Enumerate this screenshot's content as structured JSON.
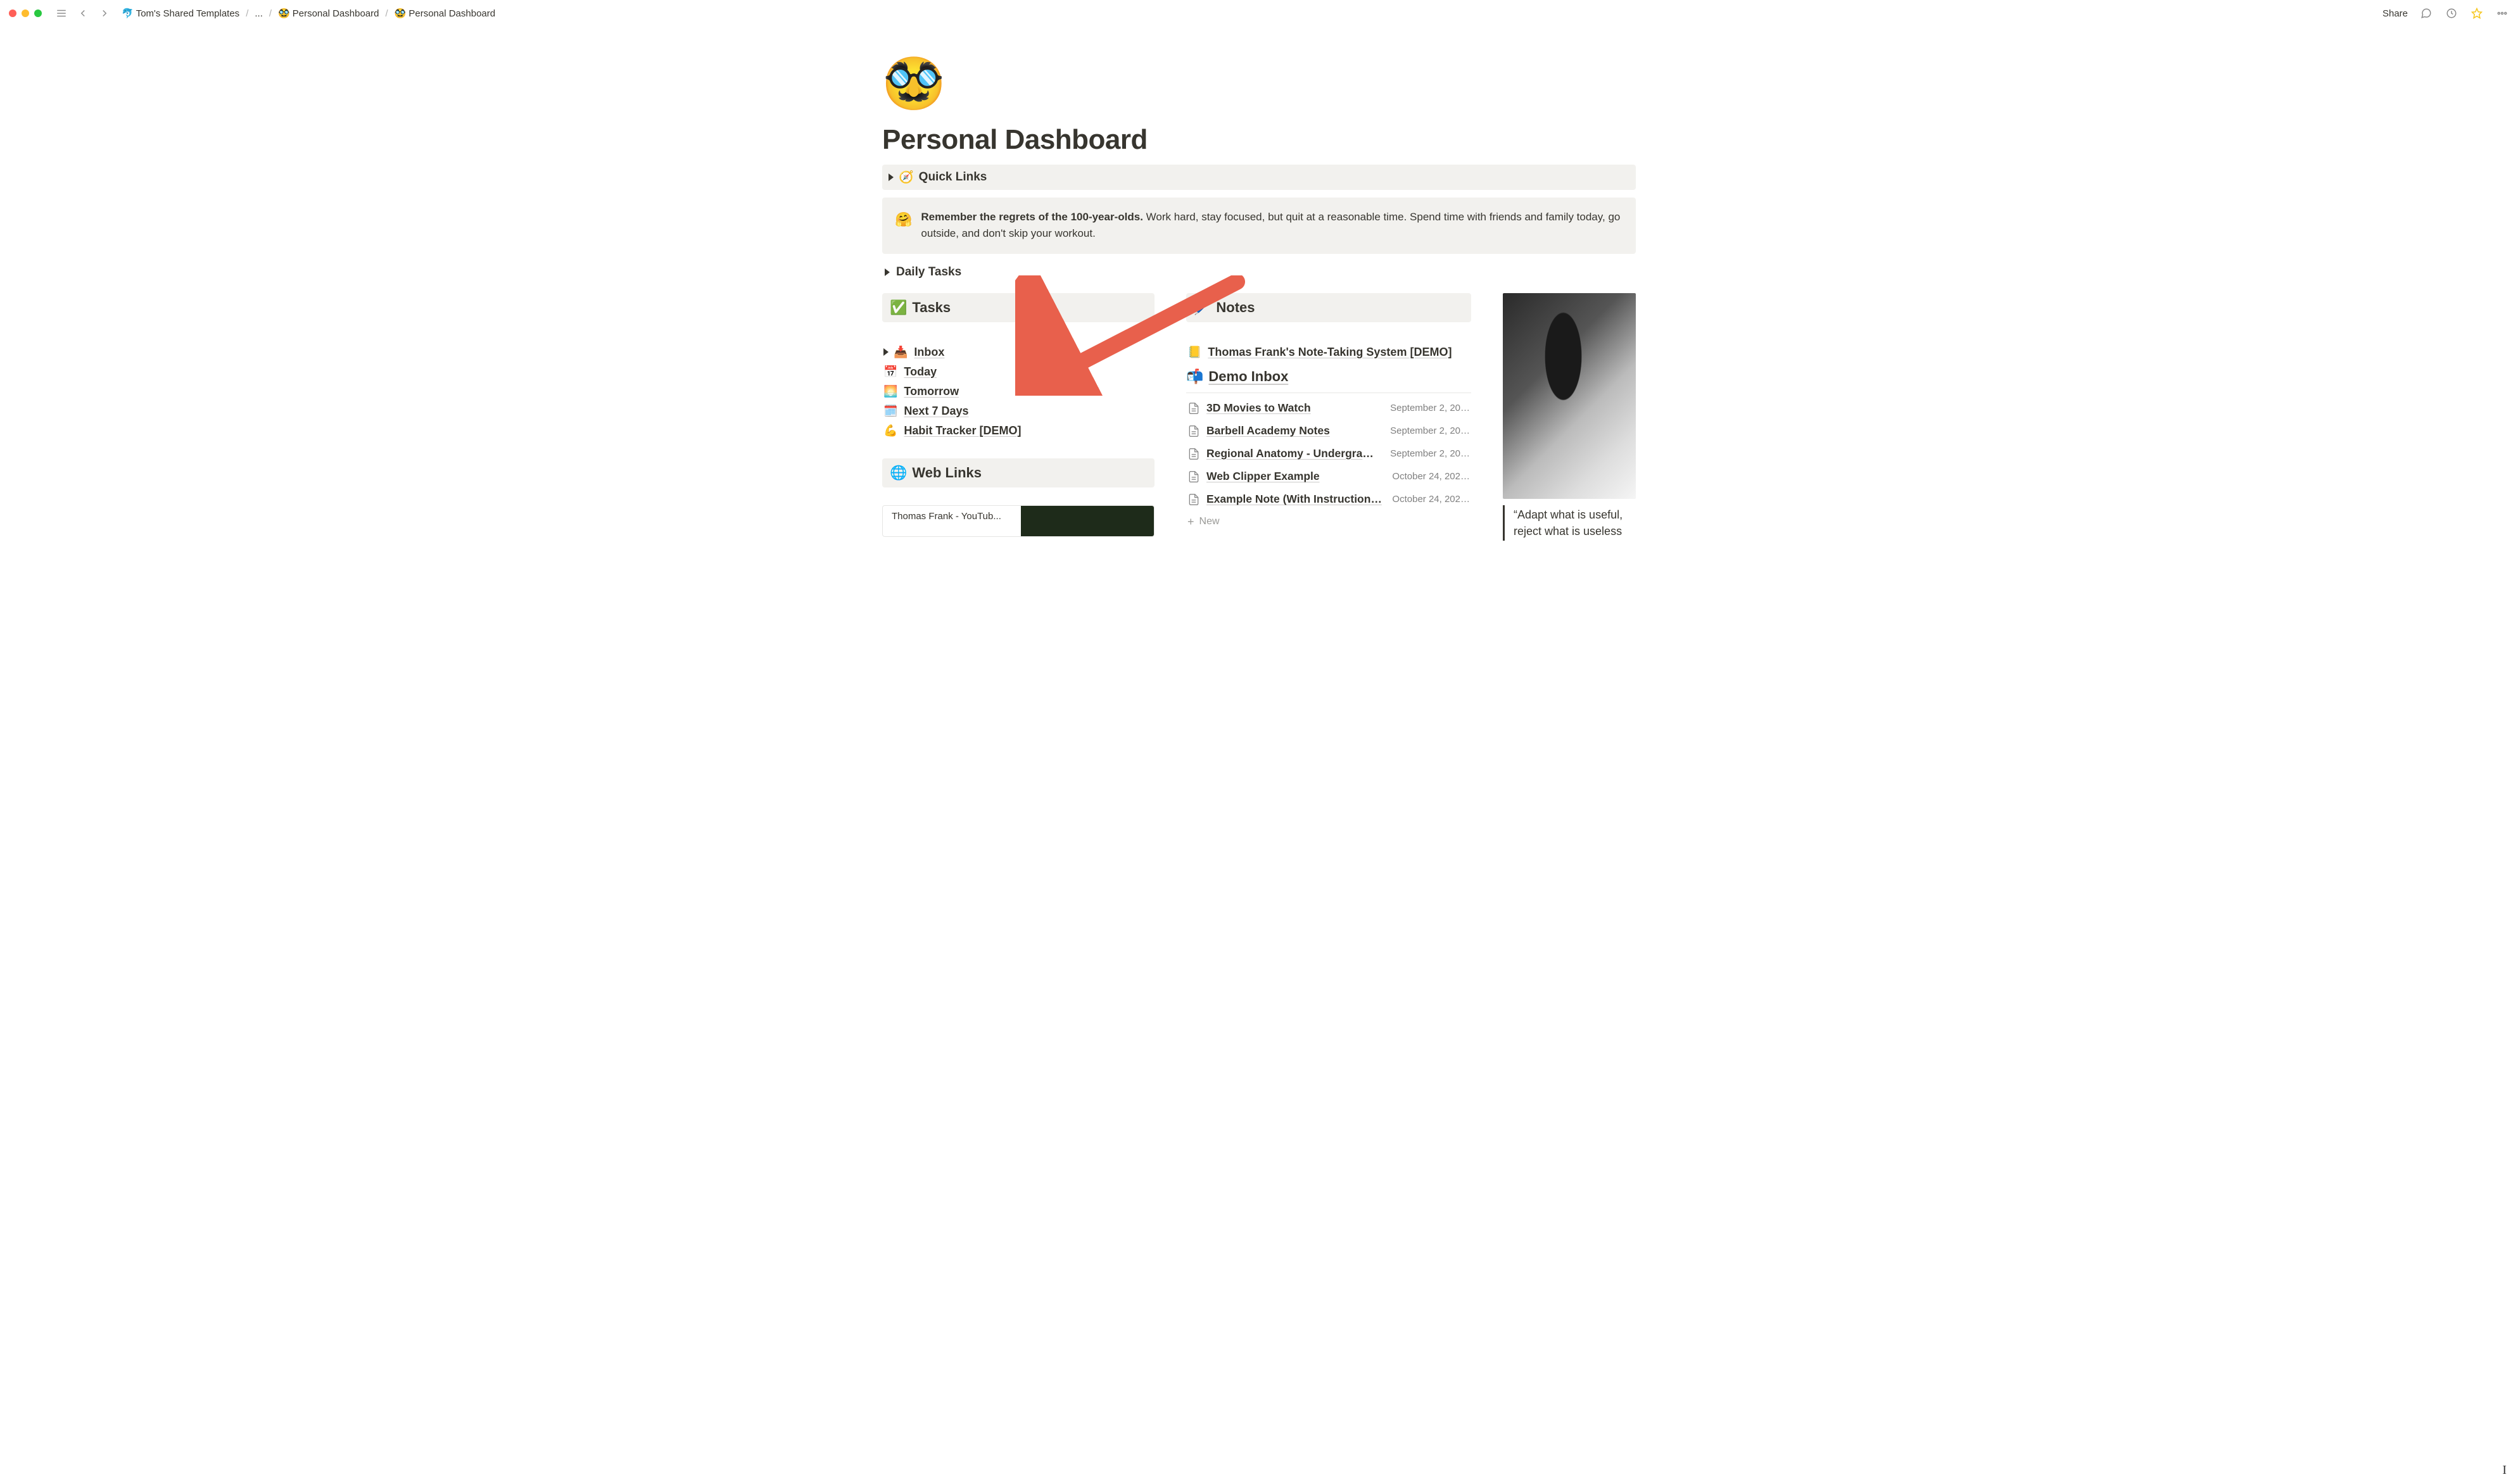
{
  "breadcrumb": {
    "root_icon": "🐬",
    "root": "Tom's Shared Templates",
    "ellipsis": "...",
    "mid_icon": "🥸",
    "mid": "Personal Dashboard",
    "current_icon": "🥸",
    "current": "Personal Dashboard"
  },
  "topbar": {
    "share": "Share"
  },
  "page": {
    "icon": "🥸",
    "title": "Personal Dashboard"
  },
  "quick_links": {
    "icon": "🧭",
    "label": "Quick Links"
  },
  "callout": {
    "icon": "🤗",
    "bold": "Remember the regrets of the 100-year-olds.",
    "rest": " Work hard, stay focused, but quit at a reasonable time. Spend time with friends and family today, go outside, and don't skip your workout."
  },
  "daily_tasks": {
    "label": "Daily Tasks"
  },
  "tasks": {
    "icon": "✅",
    "label": "Tasks",
    "items": [
      {
        "icon": "📥",
        "label": "Inbox",
        "toggle": true
      },
      {
        "icon": "📅",
        "label": "Today",
        "toggle": false
      },
      {
        "icon": "🌅",
        "label": "Tomorrow",
        "toggle": false
      },
      {
        "icon": "🗓️",
        "label": "Next 7 Days",
        "toggle": false
      },
      {
        "icon": "💪",
        "label": "Habit Tracker [DEMO]",
        "toggle": false
      }
    ]
  },
  "weblinks": {
    "icon": "🌐",
    "label": "Web Links",
    "card_title": "Thomas Frank - YouTub..."
  },
  "notes": {
    "icon": "🖊️",
    "label": "Notes",
    "pinned": {
      "icon": "📒",
      "label": "Thomas Frank's Note-Taking System [DEMO]"
    },
    "inbox_header": {
      "icon": "📬",
      "label": "Demo Inbox"
    },
    "items": [
      {
        "title": "3D Movies to Watch",
        "date": "September 2, 20…"
      },
      {
        "title": "Barbell Academy Notes",
        "date": "September 2, 20…"
      },
      {
        "title": "Regional Anatomy - Undergrad…",
        "date": "September 2, 20…"
      },
      {
        "title": "Web Clipper Example",
        "date": "October 24, 202…"
      },
      {
        "title": "Example Note (With Instruction…",
        "date": "October 24, 202…"
      }
    ],
    "new_label": "New"
  },
  "quote": {
    "text": "“Adapt what is useful, reject what is useless"
  },
  "colors": {
    "arrow": "#e8604c"
  }
}
